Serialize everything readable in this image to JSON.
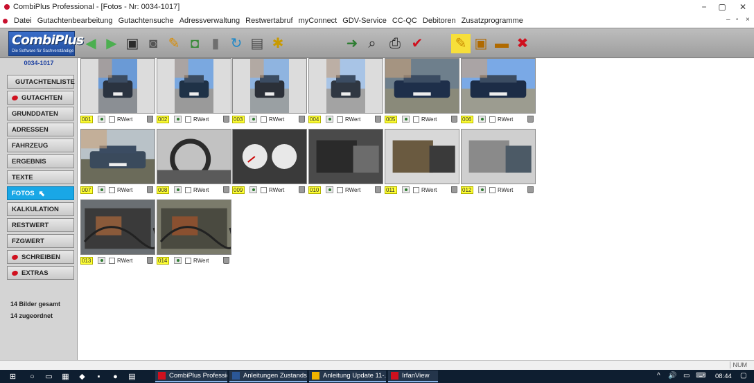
{
  "window": {
    "title": "CombiPlus Professional - [Fotos - Nr: 0034-1017]",
    "controls": {
      "minimize": "−",
      "maximize": "▢",
      "close": "✕"
    },
    "mdi_controls": {
      "minimize": "–",
      "restore": "▫",
      "close": "×"
    }
  },
  "menu": [
    "Datei",
    "Gutachtenbearbeitung",
    "Gutachtensuche",
    "Adressverwaltung",
    "Restwertabruf",
    "myConnect",
    "GDV-Service",
    "CC-QC",
    "Debitoren",
    "Zusatzprogramme"
  ],
  "logo": {
    "text": "CombiPlus",
    "tagline": "Die Software für Sachverständige"
  },
  "toolbar": {
    "buttons": [
      {
        "name": "back-arrow-icon",
        "glyph": "◀",
        "color": "#4caf50"
      },
      {
        "name": "forward-arrow-icon",
        "glyph": "▶",
        "color": "#4caf50"
      },
      {
        "name": "save-icon",
        "glyph": "▣",
        "color": "#2b2b2b"
      },
      {
        "name": "camera-icon",
        "glyph": "◙",
        "color": "#555555"
      },
      {
        "name": "edit-photo-icon",
        "glyph": "✎",
        "color": "#d98c00"
      },
      {
        "name": "import-photo-icon",
        "glyph": "◘",
        "color": "#3a8a3a"
      },
      {
        "name": "delete-icon",
        "glyph": "▮",
        "color": "#6f6f6f"
      },
      {
        "name": "refresh-icon",
        "glyph": "↻",
        "color": "#1e88c8"
      },
      {
        "name": "copy-photo-icon",
        "glyph": "▤",
        "color": "#4a4a4a"
      },
      {
        "name": "tools-icon",
        "glyph": "✱",
        "color": "#c99a00"
      },
      {
        "name": "move-icon",
        "glyph": "➜",
        "color": "#2e7d32"
      },
      {
        "name": "preview-icon",
        "glyph": "⌕",
        "color": "#2b2b2b"
      },
      {
        "name": "print-icon",
        "glyph": "⎙",
        "color": "#2b2b2b"
      },
      {
        "name": "check-icon",
        "glyph": "✔",
        "color": "#d0101e"
      },
      {
        "name": "notes-icon",
        "glyph": "✎",
        "color": "#c98b00"
      },
      {
        "name": "window-icon",
        "glyph": "▣",
        "color": "#b06a00"
      },
      {
        "name": "folder-icon",
        "glyph": "▬",
        "color": "#b06a00"
      },
      {
        "name": "close-x-icon",
        "glyph": "✖",
        "color": "#d0101e"
      }
    ]
  },
  "sidebar": {
    "case_number": "0034-1017",
    "items": [
      {
        "label": "GUTACHTENLISTE",
        "dot": true
      },
      {
        "label": "GUTACHTEN",
        "dot": true
      },
      {
        "label": "GRUNDDATEN",
        "dot": false
      },
      {
        "label": "ADRESSEN",
        "dot": false
      },
      {
        "label": "FAHRZEUG",
        "dot": false
      },
      {
        "label": "ERGEBNIS",
        "dot": false
      },
      {
        "label": "TEXTE",
        "dot": false
      },
      {
        "label": "FOTOS",
        "dot": false,
        "active": true
      },
      {
        "label": "KALKULATION",
        "dot": false
      },
      {
        "label": "RESTWERT",
        "dot": false
      },
      {
        "label": "FZGWERT",
        "dot": false
      },
      {
        "label": "SCHREIBEN",
        "dot": true
      },
      {
        "label": "EXTRAS",
        "dot": true
      }
    ],
    "stats": {
      "total": "14 Bilder gesamt",
      "assigned": "14 zugeordnet"
    }
  },
  "photos": [
    {
      "number": "001",
      "rwert": "RWert",
      "subject": "car-front-portrait",
      "palette": [
        "#6a9ad6",
        "#2a3340",
        "#8b8f94"
      ]
    },
    {
      "number": "002",
      "rwert": "RWert",
      "subject": "car-front-portrait",
      "palette": [
        "#7aa8e0",
        "#1f3247",
        "#9a9a9a"
      ]
    },
    {
      "number": "003",
      "rwert": "RWert",
      "subject": "car-rear-portrait",
      "palette": [
        "#8fb4e0",
        "#2b3038",
        "#9aa0a3"
      ]
    },
    {
      "number": "004",
      "rwert": "RWert",
      "subject": "car-rear-portrait",
      "palette": [
        "#a8c4e6",
        "#2f3742",
        "#a3a3a3"
      ]
    },
    {
      "number": "005",
      "rwert": "RWert",
      "subject": "car-hood",
      "palette": [
        "#6e7f8c",
        "#1e2f4a",
        "#8a8a7a"
      ]
    },
    {
      "number": "006",
      "rwert": "RWert",
      "subject": "car-front",
      "palette": [
        "#7aa9e6",
        "#1c2c46",
        "#9c9c90"
      ]
    },
    {
      "number": "007",
      "rwert": "RWert",
      "subject": "car-interior",
      "palette": [
        "#b9c2c8",
        "#3a4a5c",
        "#6b6b5a"
      ]
    },
    {
      "number": "008",
      "rwert": "RWert",
      "subject": "steering-wheel",
      "palette": [
        "#c2c2c2",
        "#2a2a2a",
        "#5a5a5a"
      ]
    },
    {
      "number": "009",
      "rwert": "RWert",
      "subject": "instrument-cluster",
      "palette": [
        "#3a3a3a",
        "#e8e8e8",
        "#1a1a1a"
      ]
    },
    {
      "number": "010",
      "rwert": "RWert",
      "subject": "dashboard",
      "palette": [
        "#4a4a4a",
        "#2a2a2a",
        "#6c6c6c"
      ]
    },
    {
      "number": "011",
      "rwert": "RWert",
      "subject": "door-panel",
      "palette": [
        "#d8d8d8",
        "#6a5a40",
        "#3a3a3a"
      ]
    },
    {
      "number": "012",
      "rwert": "RWert",
      "subject": "seats",
      "palette": [
        "#cfcfcf",
        "#8a8a8a",
        "#4c5a66"
      ]
    },
    {
      "number": "013",
      "rwert": "RWert",
      "subject": "engine-bay",
      "palette": [
        "#6a6f73",
        "#8a5a3a",
        "#3a3a3a"
      ]
    },
    {
      "number": "014",
      "rwert": "RWert",
      "subject": "engine-detail",
      "palette": [
        "#7b7b6b",
        "#8a5030",
        "#4a4a40"
      ]
    }
  ],
  "status": {
    "num": "NUM"
  },
  "taskbar": {
    "apps": [
      {
        "label": "CombiPlus Profession...",
        "open": true,
        "color": "#d0101e"
      },
      {
        "label": "Anleitungen Zustands...",
        "open": true,
        "color": "#2b5797"
      },
      {
        "label": "Anleitung Update 11-...",
        "open": true,
        "color": "#f0b400"
      },
      {
        "label": "IrfanView",
        "open": true,
        "color": "#d0101e"
      }
    ],
    "clock": "08:44",
    "tray": {
      "chevron": "^",
      "volume": "🔊",
      "network": "▭",
      "keyboard": "⌨",
      "notify": "▢"
    }
  }
}
